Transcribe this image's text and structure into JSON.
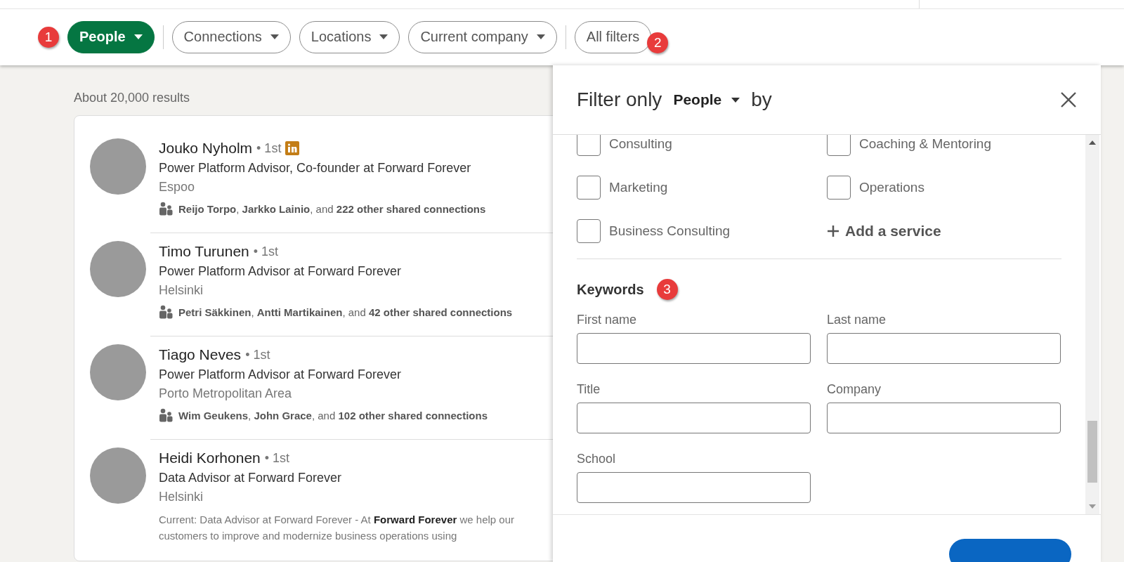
{
  "filter_bar": {
    "lead_annotation": "1",
    "trail_annotation": "2",
    "chips": [
      {
        "label": "People",
        "selected": true,
        "dropdown": true
      },
      {
        "label": "Connections",
        "selected": false,
        "dropdown": true
      },
      {
        "label": "Locations",
        "selected": false,
        "dropdown": true
      },
      {
        "label": "Current company",
        "selected": false,
        "dropdown": true
      },
      {
        "label": "All filters",
        "selected": false,
        "dropdown": false
      }
    ]
  },
  "results": {
    "count": "About 20,000 results",
    "people": [
      {
        "name": "Jouko Nyholm",
        "degree": "• 1st",
        "premium": true,
        "headline": "Power Platform Advisor, Co-founder at Forward Forever",
        "location": "Espoo",
        "shared": "**Reijo Torpo**, **Jarkko Lainio**, and **222 other shared connections**"
      },
      {
        "name": "Timo Turunen",
        "degree": "• 1st",
        "premium": false,
        "headline": "Power Platform Advisor at Forward Forever",
        "location": "Helsinki",
        "shared": "**Petri Säkkinen**, **Antti Martikainen**, and **42 other shared connections**"
      },
      {
        "name": "Tiago Neves",
        "degree": "• 1st",
        "premium": false,
        "headline": "Power Platform Advisor at Forward Forever",
        "location": "Porto Metropolitan Area",
        "shared": "**Wim Geukens**, **John Grace**, and **102 other shared connections**"
      },
      {
        "name": "Heidi Korhonen",
        "degree": "• 1st",
        "premium": false,
        "headline": "Data Advisor at Forward Forever",
        "location": "Helsinki",
        "snippet": "Current: Data Advisor at Forward Forever - At **Forward Forever** we help our customers to improve and modernize business operations using"
      }
    ]
  },
  "filter_panel": {
    "title_prefix": "Filter only",
    "type_dropdown": "People",
    "title_suffix": "by",
    "services": [
      {
        "label": "Consulting",
        "checked": false
      },
      {
        "label": "Coaching & Mentoring",
        "checked": false
      },
      {
        "label": "Marketing",
        "checked": false
      },
      {
        "label": "Operations",
        "checked": false
      },
      {
        "label": "Business Consulting",
        "checked": false
      }
    ],
    "add_service": "Add a service",
    "keywords": {
      "heading": "Keywords",
      "annotation": "3",
      "fields": [
        {
          "label": "First name"
        },
        {
          "label": "Last name"
        },
        {
          "label": "Title"
        },
        {
          "label": "Company"
        },
        {
          "label": "School"
        }
      ]
    }
  }
}
